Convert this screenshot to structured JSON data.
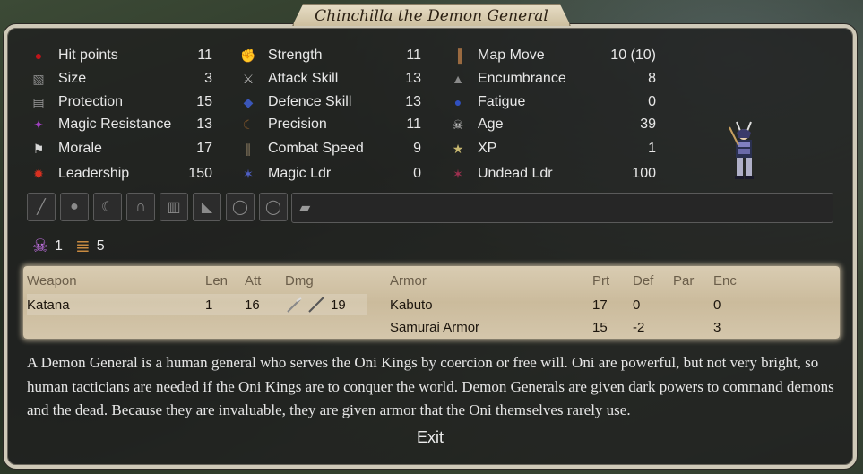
{
  "title": "Chinchilla the Demon General",
  "stats_col1": [
    {
      "label": "Hit points",
      "value": "11",
      "icon": "blood-drop-icon",
      "glyph": "●",
      "color": "#c0141a"
    },
    {
      "label": "Size",
      "value": "3",
      "icon": "size-icon",
      "glyph": "▧",
      "color": "#8a8a8a"
    },
    {
      "label": "Protection",
      "value": "15",
      "icon": "armor-icon",
      "glyph": "▤",
      "color": "#9a9a9a"
    },
    {
      "label": "Magic Resistance",
      "value": "13",
      "icon": "magic-resistance-icon",
      "glyph": "✦",
      "color": "#a040c0"
    },
    {
      "label": "Morale",
      "value": "17",
      "icon": "banner-icon",
      "glyph": "⚑",
      "color": "#d8d8d8"
    },
    {
      "label": "Leadership",
      "value": "150",
      "icon": "leadership-icon",
      "glyph": "✹",
      "color": "#d83020"
    }
  ],
  "stats_col2": [
    {
      "label": "Strength",
      "value": "11",
      "icon": "strength-arm-icon",
      "glyph": "✊",
      "color": "#d88a50"
    },
    {
      "label": "Attack Skill",
      "value": "13",
      "icon": "sword-icon",
      "glyph": "⚔",
      "color": "#b8b8b8"
    },
    {
      "label": "Defence Skill",
      "value": "13",
      "icon": "shield-icon",
      "glyph": "◆",
      "color": "#3a56b8"
    },
    {
      "label": "Precision",
      "value": "11",
      "icon": "bow-icon",
      "glyph": "☾",
      "color": "#8a5a2a"
    },
    {
      "label": "Combat Speed",
      "value": "9",
      "icon": "speed-icon",
      "glyph": "∥",
      "color": "#8a7a60"
    },
    {
      "label": "Magic Ldr",
      "value": "0",
      "icon": "magic-leader-icon",
      "glyph": "✶",
      "color": "#5060c8"
    }
  ],
  "stats_col3": [
    {
      "label": "Map Move",
      "value": "10 (10)",
      "icon": "boot-icon",
      "glyph": "▐",
      "color": "#9a6a40"
    },
    {
      "label": "Encumbrance",
      "value": "8",
      "icon": "weight-icon",
      "glyph": "▲",
      "color": "#8a8a8a"
    },
    {
      "label": "Fatigue",
      "value": "0",
      "icon": "fatigue-drop-icon",
      "glyph": "●",
      "color": "#3050c0"
    },
    {
      "label": "Age",
      "value": "39",
      "icon": "skull-icon",
      "glyph": "☠",
      "color": "#d0d0d0"
    },
    {
      "label": "XP",
      "value": "1",
      "icon": "xp-star-icon",
      "glyph": "★",
      "color": "#c8b870"
    },
    {
      "label": "Undead Ldr",
      "value": "100",
      "icon": "undead-leader-icon",
      "glyph": "✶",
      "color": "#a03050"
    }
  ],
  "slots": [
    {
      "icon": "weapon-slot-icon",
      "glyph": "╱"
    },
    {
      "icon": "shield-slot-icon",
      "glyph": "●"
    },
    {
      "icon": "bow-slot-icon",
      "glyph": "☾"
    },
    {
      "icon": "helmet-slot-icon",
      "glyph": "∩"
    },
    {
      "icon": "body-armor-slot-icon",
      "glyph": "▥"
    },
    {
      "icon": "boots-slot-icon",
      "glyph": "◣"
    },
    {
      "icon": "ring-slot-icon",
      "glyph": "◯"
    },
    {
      "icon": "ring-slot-icon",
      "glyph": "◯"
    },
    {
      "icon": "misc-slot-icon",
      "glyph": "▰"
    }
  ],
  "paths": [
    {
      "icon": "death-path-skull-icon",
      "glyph": "☠",
      "color": "#c070e0",
      "value": "1"
    },
    {
      "icon": "bless-path-icon",
      "glyph": "≣",
      "color": "#c88a40",
      "value": "5"
    }
  ],
  "weapons": {
    "headers": {
      "name": "Weapon",
      "len": "Len",
      "att": "Att",
      "dmg": "Dmg"
    },
    "rows": [
      {
        "name": "Katana",
        "len": "1",
        "att": "16",
        "dmg": "19"
      }
    ]
  },
  "armor": {
    "headers": {
      "name": "Armor",
      "prt": "Prt",
      "def": "Def",
      "par": "Par",
      "enc": "Enc"
    },
    "rows": [
      {
        "name": "Kabuto",
        "prt": "17",
        "def": "0",
        "par": "",
        "enc": "0"
      },
      {
        "name": "Samurai Armor",
        "prt": "15",
        "def": "-2",
        "par": "",
        "enc": "3"
      }
    ]
  },
  "description": "A Demon General is a human general who serves the Oni Kings by coercion or free will. Oni are powerful, but not very bright, so human tacticians are needed if the Oni Kings are to conquer the world. Demon Generals are given dark powers to command demons and the dead. Because they are invaluable, they are given armor that the Oni themselves rarely use.",
  "exit_label": "Exit",
  "unit_sprite": "samurai-sprite-icon"
}
